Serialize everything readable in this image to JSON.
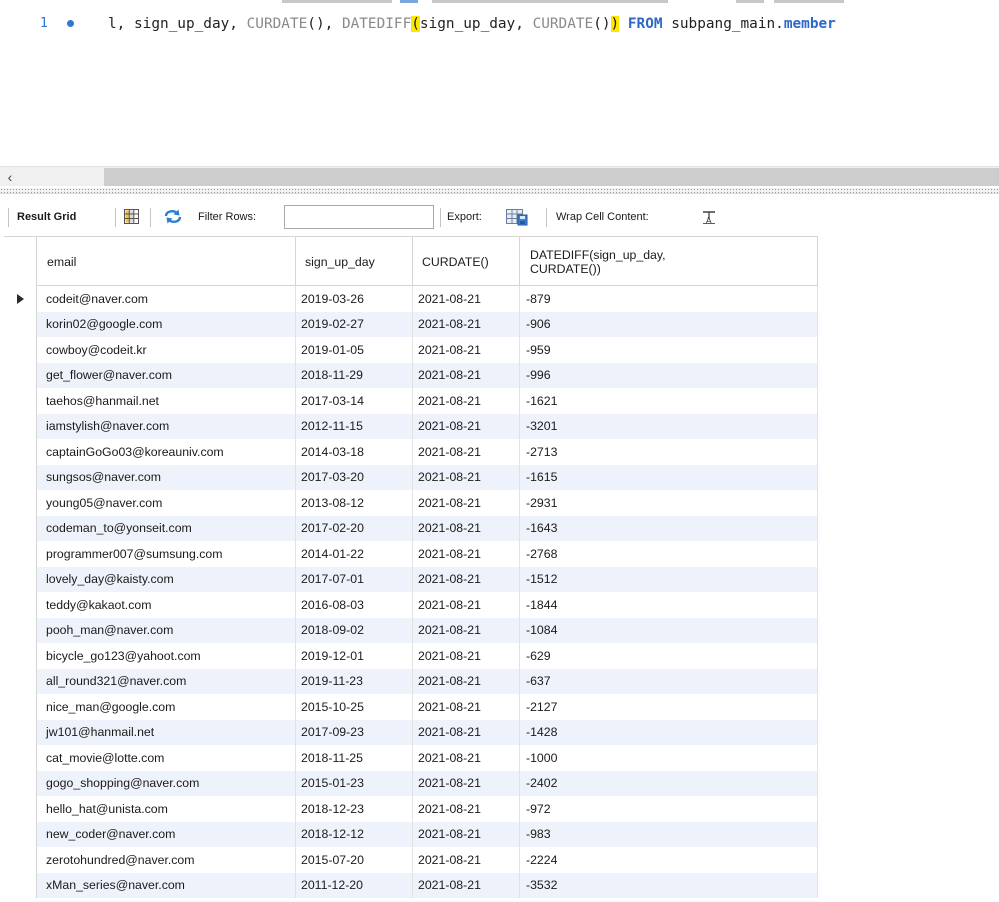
{
  "editor": {
    "line_number": "1",
    "code_segments": [
      {
        "text": "l, sign_up_day, ",
        "cls": "tok-id"
      },
      {
        "text": "CURDATE",
        "cls": "tok-fn"
      },
      {
        "text": "(), ",
        "cls": "tok-id"
      },
      {
        "text": "DATEDIFF",
        "cls": "tok-fn"
      },
      {
        "text": "(",
        "cls": "paren-hl"
      },
      {
        "text": "sign_up_day, ",
        "cls": "tok-id"
      },
      {
        "text": "CURDATE",
        "cls": "tok-fn"
      },
      {
        "text": "()",
        "cls": "tok-id"
      },
      {
        "text": ")",
        "cls": "paren-hl"
      },
      {
        "text": " ",
        "cls": "tok-id"
      },
      {
        "text": "FROM",
        "cls": "tok-kw"
      },
      {
        "text": " subpang_main.",
        "cls": "tok-schema"
      },
      {
        "text": "member",
        "cls": "tok-tbl"
      }
    ]
  },
  "scrollbar": {
    "left_arrow": "‹"
  },
  "toolbar": {
    "result_grid_label": "Result Grid",
    "filter_rows_label": "Filter Rows:",
    "filter_rows_value": "",
    "export_label": "Export:",
    "wrap_label": "Wrap Cell Content:"
  },
  "grid": {
    "columns": [
      "email",
      "sign_up_day",
      "CURDATE()",
      "DATEDIFF(sign_up_day,\nCURDATE())"
    ],
    "rows": [
      [
        "codeit@naver.com",
        "2019-03-26",
        "2021-08-21",
        "-879"
      ],
      [
        "korin02@google.com",
        "2019-02-27",
        "2021-08-21",
        "-906"
      ],
      [
        "cowboy@codeit.kr",
        "2019-01-05",
        "2021-08-21",
        "-959"
      ],
      [
        "get_flower@naver.com",
        "2018-11-29",
        "2021-08-21",
        "-996"
      ],
      [
        "taehos@hanmail.net",
        "2017-03-14",
        "2021-08-21",
        "-1621"
      ],
      [
        "iamstylish@naver.com",
        "2012-11-15",
        "2021-08-21",
        "-3201"
      ],
      [
        "captainGoGo03@koreauniv.com",
        "2014-03-18",
        "2021-08-21",
        "-2713"
      ],
      [
        "sungsos@naver.com",
        "2017-03-20",
        "2021-08-21",
        "-1615"
      ],
      [
        "young05@naver.com",
        "2013-08-12",
        "2021-08-21",
        "-2931"
      ],
      [
        "codeman_to@yonseit.com",
        "2017-02-20",
        "2021-08-21",
        "-1643"
      ],
      [
        "programmer007@sumsung.com",
        "2014-01-22",
        "2021-08-21",
        "-2768"
      ],
      [
        "lovely_day@kaisty.com",
        "2017-07-01",
        "2021-08-21",
        "-1512"
      ],
      [
        "teddy@kakaot.com",
        "2016-08-03",
        "2021-08-21",
        "-1844"
      ],
      [
        "pooh_man@naver.com",
        "2018-09-02",
        "2021-08-21",
        "-1084"
      ],
      [
        "bicycle_go123@yahoot.com",
        "2019-12-01",
        "2021-08-21",
        "-629"
      ],
      [
        "all_round321@naver.com",
        "2019-11-23",
        "2021-08-21",
        "-637"
      ],
      [
        "nice_man@google.com",
        "2015-10-25",
        "2021-08-21",
        "-2127"
      ],
      [
        "jw101@hanmail.net",
        "2017-09-23",
        "2021-08-21",
        "-1428"
      ],
      [
        "cat_movie@lotte.com",
        "2018-11-25",
        "2021-08-21",
        "-1000"
      ],
      [
        "gogo_shopping@naver.com",
        "2015-01-23",
        "2021-08-21",
        "-2402"
      ],
      [
        "hello_hat@unista.com",
        "2018-12-23",
        "2021-08-21",
        "-972"
      ],
      [
        "new_coder@naver.com",
        "2018-12-12",
        "2021-08-21",
        "-983"
      ],
      [
        "zerotohundred@naver.com",
        "2015-07-20",
        "2021-08-21",
        "-2224"
      ],
      [
        "xMan_series@naver.com",
        "2011-12-20",
        "2021-08-21",
        "-3532"
      ]
    ],
    "current_row": 0
  },
  "icons": {
    "grid_icon": "grid-view-icon",
    "refresh_icon": "refresh-arrows-icon",
    "export_icon": "export-table-icon",
    "wrap_icon": "wrap-text-icon",
    "row_pointer": "row-pointer-icon"
  },
  "colors": {
    "keyword": "#2d68c6",
    "function": "#8a8a8a",
    "bracket_highlight": "#ffe800",
    "alt_row": "#eef2fb"
  }
}
